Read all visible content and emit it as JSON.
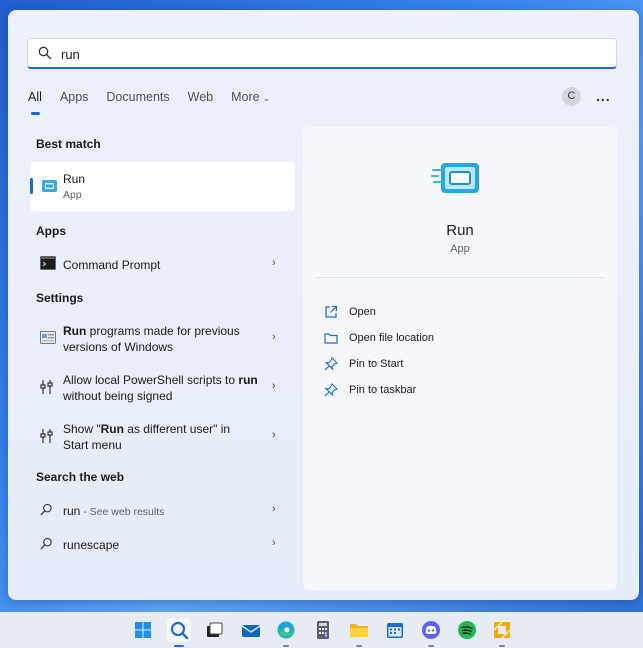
{
  "search": {
    "value": "run",
    "placeholder": ""
  },
  "tabs": [
    {
      "label": "All"
    },
    {
      "label": "Apps"
    },
    {
      "label": "Documents"
    },
    {
      "label": "Web"
    },
    {
      "label": "More"
    }
  ],
  "account": {
    "initial": "C",
    "menu_label": "..."
  },
  "best_match": {
    "heading": "Best match",
    "name": "Run",
    "type": "App"
  },
  "apps": {
    "heading": "Apps",
    "items": [
      {
        "label": "Command Prompt"
      }
    ]
  },
  "settings": {
    "heading": "Settings",
    "items": [
      {
        "bold": "Run",
        "rest": " programs made for previous versions of Windows"
      },
      {
        "pre": "Allow local PowerShell scripts to ",
        "bold": "run",
        "rest": " without being signed"
      },
      {
        "pre": "Show \"",
        "bold": "Run",
        "rest": " as different user\" in Start menu"
      }
    ]
  },
  "web": {
    "heading": "Search the web",
    "items": [
      {
        "label": "run",
        "suffix": " - See web results"
      },
      {
        "label": "runescape"
      }
    ]
  },
  "detail": {
    "title": "Run",
    "subtitle": "App",
    "actions": [
      {
        "label": "Open",
        "icon": "open-external-icon"
      },
      {
        "label": "Open file location",
        "icon": "folder-icon"
      },
      {
        "label": "Pin to Start",
        "icon": "pin-icon"
      },
      {
        "label": "Pin to taskbar",
        "icon": "pin-icon"
      }
    ]
  },
  "taskbar": {
    "icons": [
      "windows-start-icon",
      "search-icon",
      "task-view-icon",
      "mail-icon",
      "edge-icon",
      "calculator-icon",
      "file-explorer-icon",
      "calendar-icon",
      "discord-icon",
      "spotify-icon",
      "vmware-icon"
    ]
  },
  "colors": {
    "accent": "#1d6ae0",
    "panel": "#eef1fb",
    "detail_bg": "#f7f8fb"
  }
}
